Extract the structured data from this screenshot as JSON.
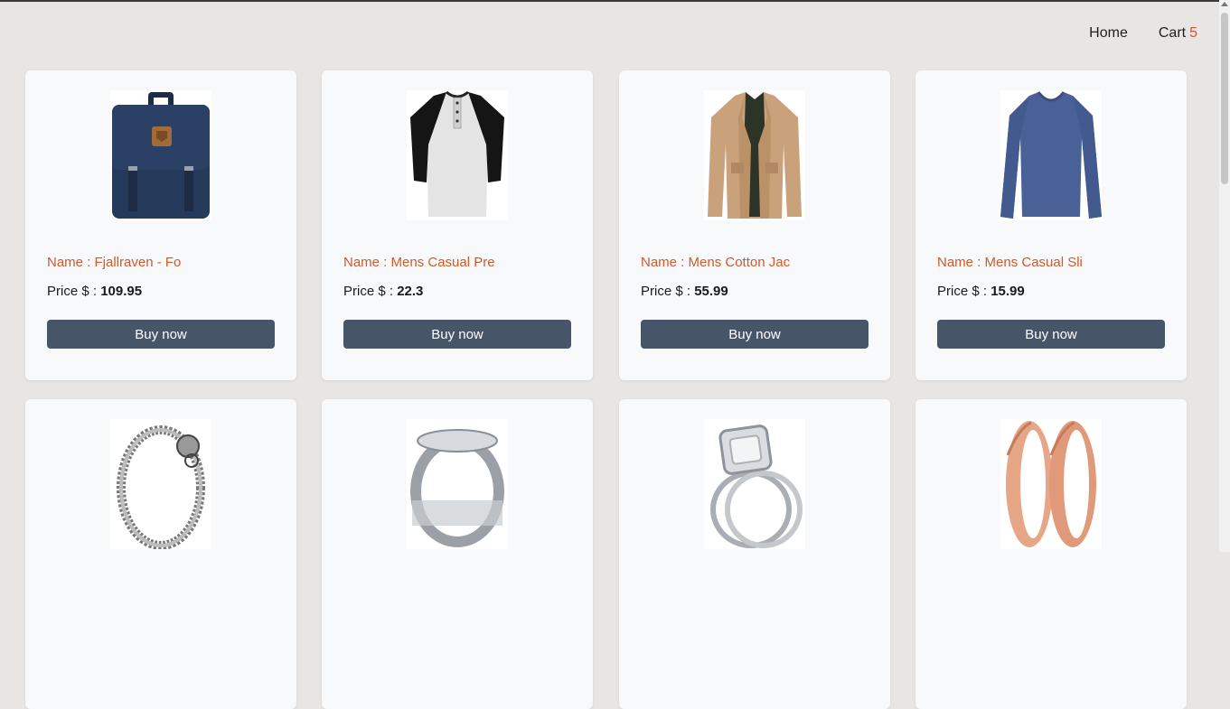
{
  "nav": {
    "home": "Home",
    "cart": "Cart",
    "cart_count": "5"
  },
  "common": {
    "name_prefix": "Name : ",
    "price_prefix": "Price $ : ",
    "buy_label": "Buy now"
  },
  "products": [
    {
      "name": "Fjallraven - Fo",
      "price": "109.95",
      "image": "backpack"
    },
    {
      "name": "Mens Casual Pre",
      "price": "22.3",
      "image": "raglan-shirt"
    },
    {
      "name": "Mens Cotton Jac",
      "price": "55.99",
      "image": "jacket"
    },
    {
      "name": "Mens Casual Sli",
      "price": "15.99",
      "image": "long-sleeve-shirt"
    },
    {
      "image": "bracelet"
    },
    {
      "image": "silver-ring"
    },
    {
      "image": "engagement-ring-set"
    },
    {
      "image": "rose-gold-earrings"
    }
  ],
  "colors": {
    "accent": "#cf5a2c",
    "button": "#475569",
    "background": "#e8e6e4",
    "card": "#f7f9fb"
  }
}
